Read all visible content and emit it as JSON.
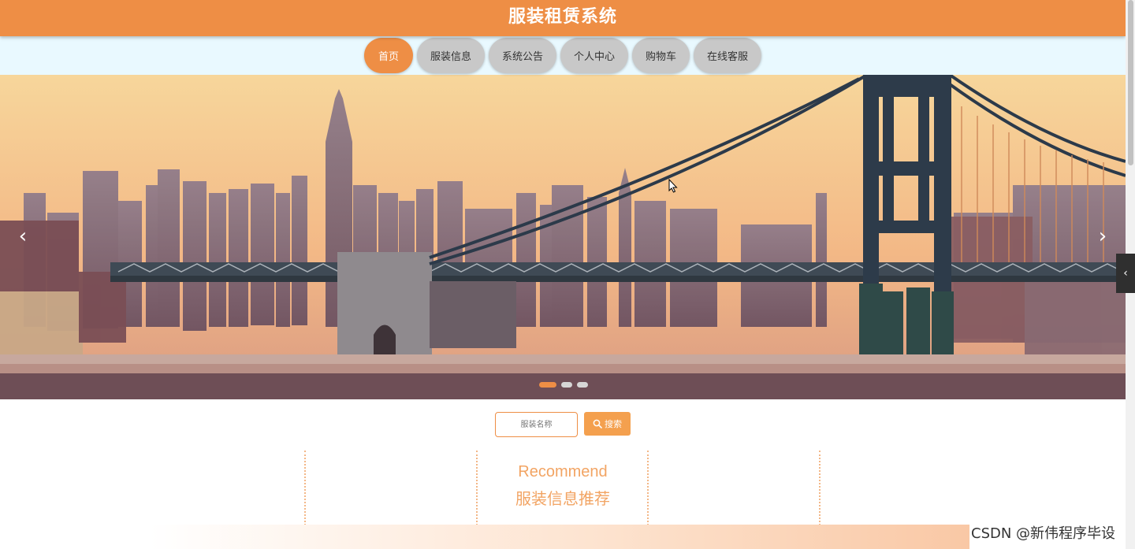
{
  "header": {
    "title": "服装租赁系统"
  },
  "nav": {
    "items": [
      {
        "label": "首页",
        "active": true
      },
      {
        "label": "服装信息",
        "active": false
      },
      {
        "label": "系统公告",
        "active": false
      },
      {
        "label": "个人中心",
        "active": false
      },
      {
        "label": "购物车",
        "active": false
      },
      {
        "label": "在线客服",
        "active": false
      }
    ]
  },
  "banner": {
    "prev_icon": "chevron-left-icon",
    "next_icon": "chevron-right-icon",
    "slide_count": 3,
    "active_slide": 1
  },
  "search": {
    "placeholder": "服装名称",
    "button_label": "搜索",
    "button_icon": "search-icon"
  },
  "recommend": {
    "title_en": "Recommend",
    "title_zh": "服装信息推荐"
  },
  "side_tab": {
    "icon": "chevron-left-icon"
  },
  "watermark": "CSDN @新伟程序毕设",
  "colors": {
    "accent": "#ee8e45",
    "nav_bg": "#e9f9ff",
    "nav_item": "#c8c8c8",
    "search_button": "#f4a04e",
    "recommend_text": "#f2a463"
  }
}
